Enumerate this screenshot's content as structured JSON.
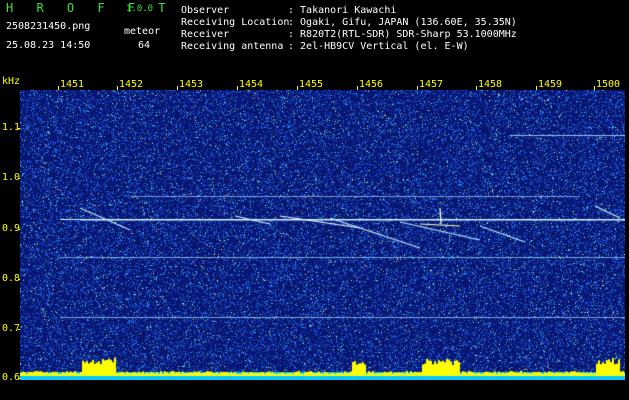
{
  "header": {
    "title": "H R O F F T",
    "version": "1.0.0",
    "filename": "2508231450.png",
    "datetime": "25.08.23 14:50",
    "meteor_label": "meteor",
    "meteor_count": "64"
  },
  "info": [
    {
      "label": "Observer",
      "value": ": Takanori Kawachi"
    },
    {
      "label": "Receiving Location",
      "value": ": Ogaki, Gifu, JAPAN (136.60E, 35.35N)"
    },
    {
      "label": "Receiver",
      "value": ": R820T2(RTL-SDR) SDR-Sharp 53.1000MHz"
    },
    {
      "label": "Receiving antenna",
      "value": ": 2el-HB9CV Vertical (el. E-W)"
    }
  ],
  "spectrogram": {
    "unit": "kHz",
    "y_ticks": [
      "1.1",
      "1.0",
      "0.9",
      "0.8",
      "0.7",
      "0.6"
    ],
    "x_ticks": [
      "1451",
      "1452",
      "1453",
      "1454",
      "1455",
      "1456",
      "1457",
      "1458",
      "1459",
      "1500"
    ],
    "colors": {
      "background": "#0a1a6a",
      "noise": "#2e4ee0",
      "signal": "#ffffff",
      "axis": "#ffff00",
      "meter": "#00c8ff"
    }
  }
}
